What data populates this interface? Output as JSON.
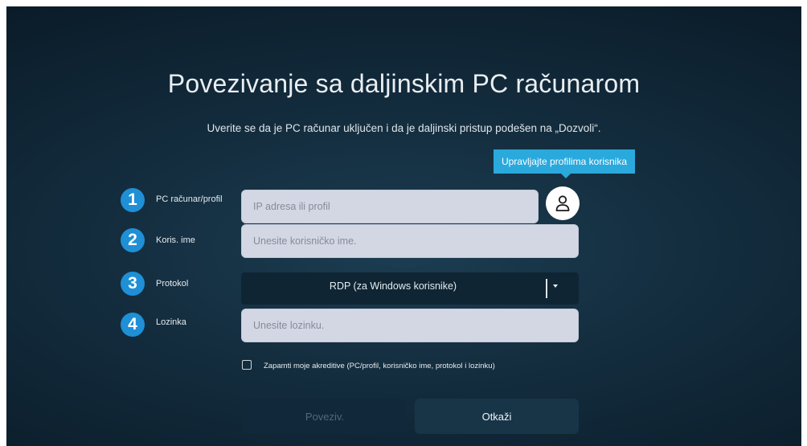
{
  "dialog": {
    "title": "Povezivanje sa daljinskim PC računarom",
    "subtitle": "Uverite se da je PC računar uključen i da je daljinski pristup podešen na „Dozvoli“."
  },
  "tooltip": {
    "text": "Upravljajte profilima korisnika"
  },
  "steps": [
    {
      "number": "1",
      "label": "PC računar/profil",
      "placeholder": "IP adresa ili profil"
    },
    {
      "number": "2",
      "label": "Koris. ime",
      "placeholder": "Unesite korisničko ime."
    },
    {
      "number": "3",
      "label": "Protokol",
      "value": "RDP (za Windows korisnike)"
    },
    {
      "number": "4",
      "label": "Lozinka",
      "placeholder": "Unesite lozinku."
    }
  ],
  "profile_button": {
    "icon": "user-icon"
  },
  "remember": {
    "label": "Zapamti moje akreditive (PC/profil, korisničko ime, protokol i lozinku)",
    "checked": false
  },
  "buttons": {
    "connect": "Poveziv.",
    "cancel": "Otkaži"
  },
  "colors": {
    "accent": "#2aa9dd",
    "step_badge": "#1f8fd6",
    "field_bg": "#d3d7e4"
  }
}
